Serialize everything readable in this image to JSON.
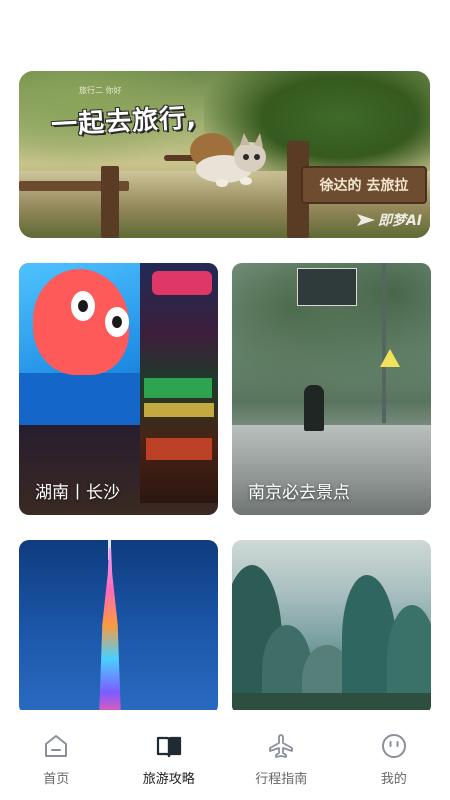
{
  "banner": {
    "title": "一起去旅行,",
    "small_text": "旅行二 你好",
    "sign_text": "徐达的 去旅拉",
    "watermark": "即梦AI"
  },
  "cards": [
    {
      "caption": "湖南丨长沙"
    },
    {
      "caption": "南京必去景点"
    },
    {
      "caption": ""
    },
    {
      "caption": ""
    }
  ],
  "tabbar": {
    "items": [
      {
        "label": "首页",
        "icon": "home-icon",
        "active": false
      },
      {
        "label": "旅游攻略",
        "icon": "book-icon",
        "active": true
      },
      {
        "label": "行程指南",
        "icon": "airplane-icon",
        "active": false
      },
      {
        "label": "我的",
        "icon": "smiley-face-icon",
        "active": false
      }
    ]
  },
  "colors": {
    "tab_inactive": "#666666",
    "tab_active": "#222222",
    "icon_inactive": "#8a9099",
    "icon_active": "#1f2a33"
  }
}
